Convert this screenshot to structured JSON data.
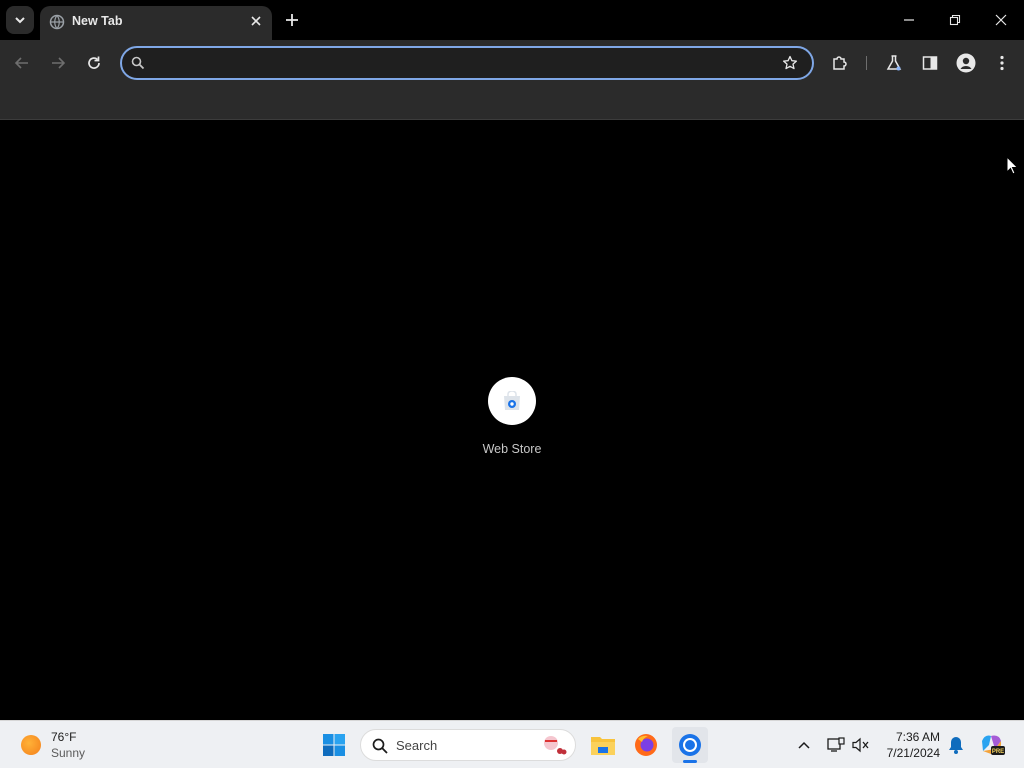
{
  "browser": {
    "tab": {
      "title": "New Tab",
      "favicon": "globe-icon"
    },
    "window_controls": [
      "minimize-icon",
      "restore-icon",
      "close-icon"
    ],
    "omnibox": {
      "value": "",
      "placeholder": ""
    },
    "toolbar_icons": [
      "back-arrow-icon",
      "forward-arrow-icon",
      "reload-icon",
      "star-icon",
      "extensions-icon",
      "labs-flask-icon",
      "side-panel-icon",
      "profile-avatar-icon",
      "kebab-menu-icon"
    ]
  },
  "new_tab_page": {
    "shortcuts": [
      {
        "label": "Web Store",
        "icon": "web-store-icon"
      }
    ]
  },
  "taskbar": {
    "weather": {
      "temp": "76°F",
      "desc": "Sunny"
    },
    "search_label": "Search",
    "apps": [
      "windows-start-icon",
      "file-explorer-icon",
      "firefox-icon",
      "chrome-icon"
    ],
    "tray": {
      "time": "7:36 AM",
      "date": "7/21/2024"
    }
  },
  "colors": {
    "tab_bg": "#2b2b2b",
    "omnibox_border": "#7fa7e6",
    "content_bg": "#000000",
    "taskbar_bg": "#eef0f3",
    "accent_blue": "#1a73e8"
  }
}
